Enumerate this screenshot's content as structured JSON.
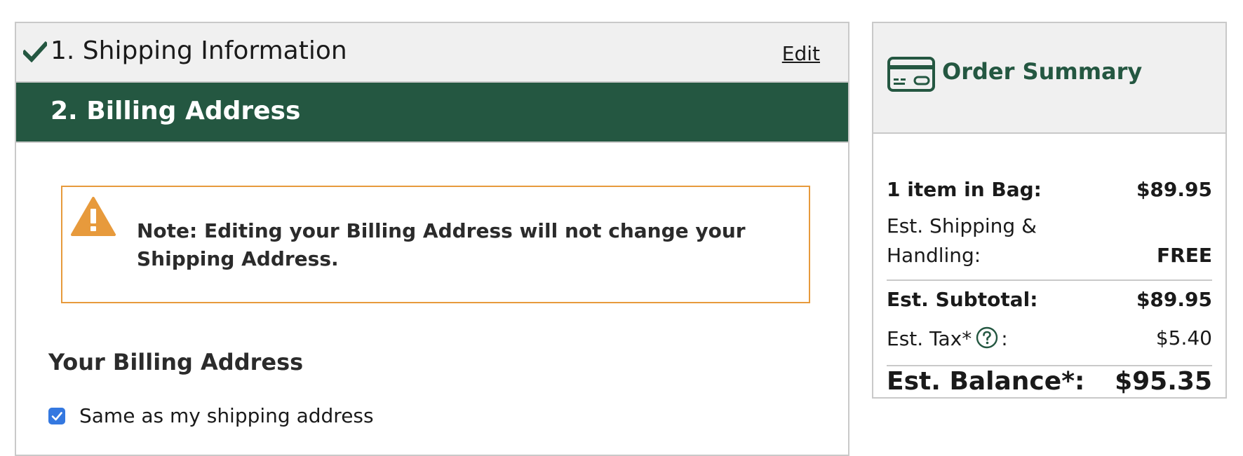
{
  "checkout": {
    "shipping_step": {
      "title": "1. Shipping Information",
      "edit_label": "Edit",
      "icon": "checkmark-icon"
    },
    "billing_step": {
      "title": "2. Billing Address"
    },
    "note": {
      "icon": "warning-icon",
      "text": "Note: Editing your Billing Address will not change your Shipping Address."
    },
    "billing_section": {
      "heading": "Your Billing Address",
      "same_as_shipping_label": "Same as my shipping address",
      "same_as_shipping_checked": true
    }
  },
  "order_summary": {
    "title": "Order Summary",
    "icon": "credit-card-icon",
    "items_label": "1 item in Bag:",
    "items_value": "$89.95",
    "shipping_label_line1": "Est. Shipping &",
    "shipping_label_line2": "Handling:",
    "shipping_value": "FREE",
    "subtotal_label": "Est. Subtotal:",
    "subtotal_value": "$89.95",
    "tax_label": "Est. Tax*",
    "tax_suffix": ":",
    "tax_value": "$5.40",
    "balance_label": "Est. Balance*:",
    "balance_value": "$95.35"
  },
  "colors": {
    "brand_green": "#245741",
    "warning_orange": "#e79a3c",
    "checkbox_blue": "#3478e0",
    "header_gray": "#f0f0f0",
    "border_gray": "#c9c9c9"
  }
}
